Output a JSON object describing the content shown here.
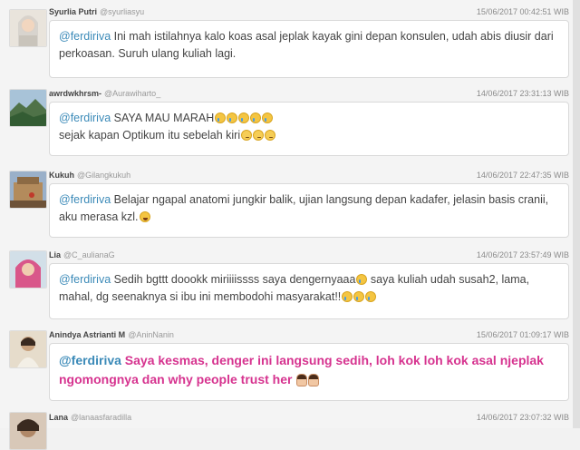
{
  "tweets": [
    {
      "name": "Syurlia Putri",
      "handle": "@syurliasyu",
      "time": "15/06/2017 00:42:51 WIB",
      "mention": "@ferdiriva",
      "text": " Ini mah istilahnya kalo koas asal jeplak kayak gini depan konsulen, udah abis diusir dari perkoasan. Suruh ulang kuliah lagi."
    },
    {
      "name": "awrdwkhrsm-",
      "handle": "@Aurawiharto_",
      "time": "14/06/2017 23:31:13 WIB",
      "mention": "@ferdiriva",
      "text": " SAYA MAU MARAH",
      "line2": "sejak kapan Optikum itu sebelah kiri"
    },
    {
      "name": "Kukuh",
      "handle": "@Gilangkukuh",
      "time": "14/06/2017 22:47:35 WIB",
      "mention": "@ferdiriva",
      "text": " Belajar ngapal anatomi jungkir balik, ujian langsung depan kadafer, jelasin basis cranii, aku merasa kzl."
    },
    {
      "name": "Lia",
      "handle": "@C_aulianaG",
      "time": "14/06/2017 23:57:49 WIB",
      "mention": "@ferdiriva",
      "text": " Sedih bgttt doookk miriiiissss saya dengernyaaa",
      "text2": " saya kuliah udah susah2, lama, mahal, dg seenaknya si ibu ini membodohi masyarakat!!"
    },
    {
      "name": "Anindya Astrianti M",
      "handle": "@AninNanin",
      "time": "15/06/2017 01:09:17 WIB",
      "mention": "@ferdiriva",
      "text": " Saya kesmas, denger ini langsung sedih, loh kok loh kok asal njeplak ngomongnya dan why people trust her"
    },
    {
      "name": "Lana",
      "handle": "@lanaasfaradilla",
      "time": "14/06/2017 23:07:32 WIB"
    }
  ]
}
